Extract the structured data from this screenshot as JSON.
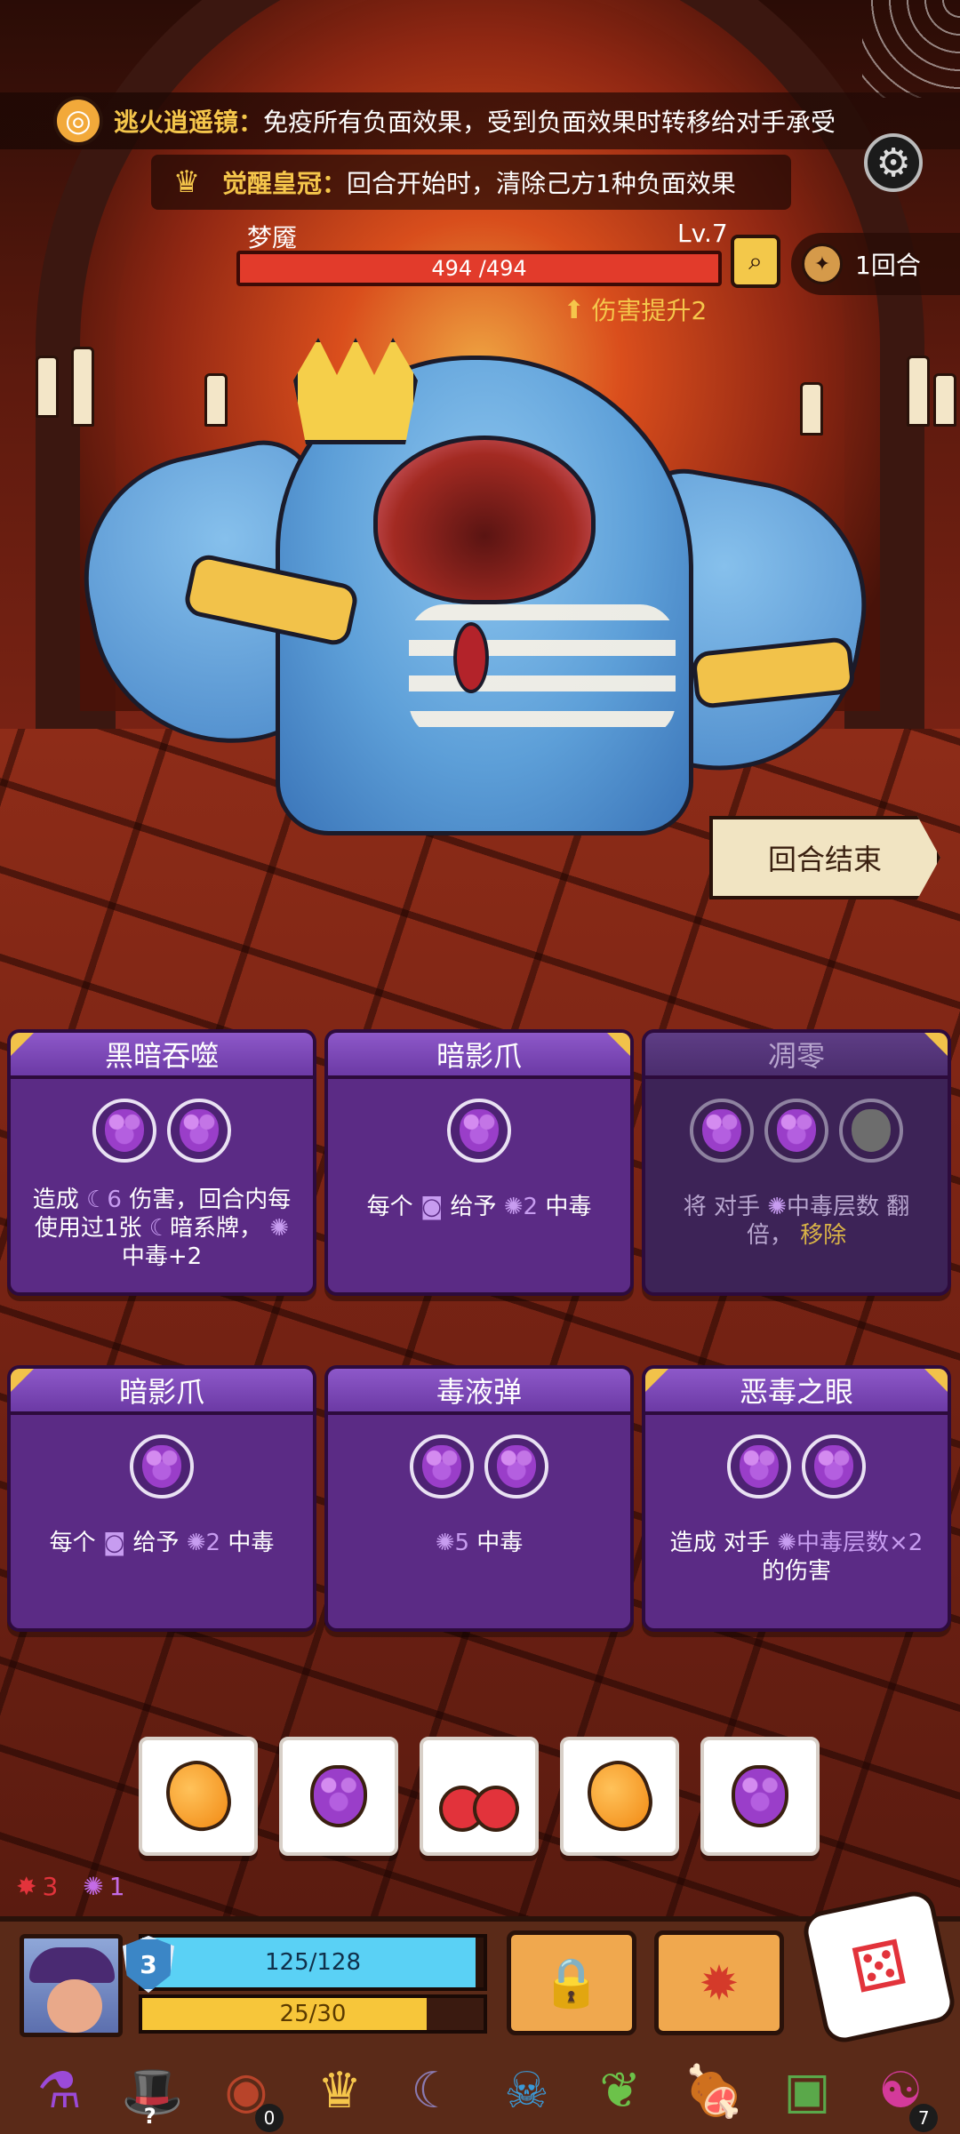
{
  "relics": [
    {
      "name": "逃火逍遥镜：",
      "desc": "免疫所有负面效果，受到负面效果时转移给对手承受",
      "icon": "mirror-icon"
    },
    {
      "name": "觉醒皇冠：",
      "desc": "回合开始时，清除己方1种负面效果",
      "icon": "crown-icon"
    }
  ],
  "enemy": {
    "name": "梦魇",
    "level": "Lv.7",
    "hp_text": "494 /494",
    "hp_fraction": 1.0,
    "buff": "伤害提升2"
  },
  "turn": {
    "label": "1回合"
  },
  "end_turn_label": "回合结束",
  "cards": [
    {
      "title": "黑暗吞噬",
      "dice": [
        "grape",
        "grape"
      ],
      "desc_parts": [
        "造成",
        "6",
        "伤害，回合内每使用过1张",
        "暗系牌，",
        "中毒+2"
      ],
      "dim": false
    },
    {
      "title": "暗影爪",
      "dice": [
        "grape"
      ],
      "desc_parts": [
        "每个",
        "给予",
        "2",
        "中毒"
      ],
      "dim": false
    },
    {
      "title": "凋零",
      "dice": [
        "grape",
        "grape",
        "gray"
      ],
      "desc_parts": [
        "将 对手",
        "中毒层数 翻倍，",
        "移除"
      ],
      "dim": true
    },
    {
      "title": "暗影爪",
      "dice": [
        "grape"
      ],
      "desc_parts": [
        "每个",
        "给予",
        "2",
        "中毒"
      ],
      "dim": false
    },
    {
      "title": "毒液弹",
      "dice": [
        "grape",
        "grape"
      ],
      "desc_parts": [
        "5",
        "中毒"
      ],
      "dim": false
    },
    {
      "title": "恶毒之眼",
      "dice": [
        "grape",
        "grape"
      ],
      "desc_parts": [
        "造成 对手",
        "中毒层数×2",
        "的伤害"
      ],
      "dim": false
    }
  ],
  "tray_dice": [
    "mango",
    "grape",
    "cherry",
    "mango",
    "grape"
  ],
  "status": {
    "fire": "3",
    "poison": "1"
  },
  "player": {
    "shield": "3",
    "hp_text": "125/128",
    "hp_fraction": 0.977,
    "energy_text": "25/30",
    "energy_fraction": 0.833
  },
  "items": [
    {
      "name": "eye-potion-icon",
      "glyph": "⚗",
      "count": ""
    },
    {
      "name": "magic-hat-icon",
      "glyph": "🎩",
      "count": "?"
    },
    {
      "name": "cursed-stone-icon",
      "glyph": "◉",
      "count": "0"
    },
    {
      "name": "crown-item-icon",
      "glyph": "♛",
      "count": ""
    },
    {
      "name": "moon-stone-icon",
      "glyph": "☾",
      "count": ""
    },
    {
      "name": "demon-mask-icon",
      "glyph": "☠",
      "count": ""
    },
    {
      "name": "leaf-icon",
      "glyph": "❦",
      "count": ""
    },
    {
      "name": "meat-icon",
      "glyph": "🍖",
      "count": ""
    },
    {
      "name": "slime-book-icon",
      "glyph": "▣",
      "count": ""
    },
    {
      "name": "yinyang-orb-icon",
      "glyph": "☯",
      "count": "7"
    }
  ]
}
